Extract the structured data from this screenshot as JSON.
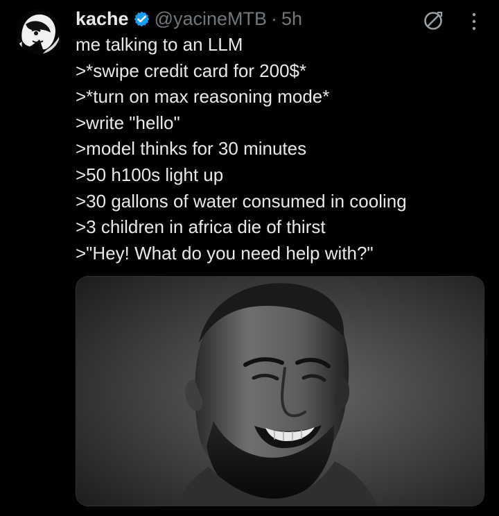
{
  "tweet": {
    "author": {
      "display_name": "kache",
      "handle": "@yacineMTB",
      "verified": true,
      "avatar_icon": "anime-avatar-icon"
    },
    "separator": "·",
    "timestamp": "5h",
    "lines": [
      "me talking to an LLM",
      ">*swipe credit card for 200$*",
      ">*turn on max reasoning mode*",
      ">write \"hello\"",
      ">model thinks for 30 minutes",
      ">50 h100s light up",
      ">30 gallons of water consumed in cooling",
      ">3 children in africa die of thirst",
      ">\"Hey! What do you need help with?\""
    ],
    "actions": {
      "grok_icon": "grok-icon",
      "more_icon": "more-vertical-icon"
    },
    "media": {
      "kind": "grayscale portrait image"
    }
  },
  "colors": {
    "background": "#000000",
    "text_primary": "#e7e9ea",
    "text_secondary": "#71767b",
    "verified_blue": "#1d9bf0",
    "border": "#2f3336"
  }
}
